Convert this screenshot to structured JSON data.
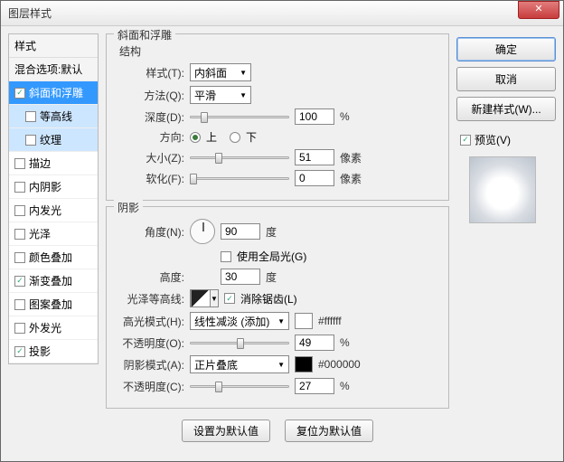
{
  "window": {
    "title": "图层样式"
  },
  "leftPanel": {
    "header": "样式",
    "blend": "混合选项:默认",
    "items": [
      {
        "label": "斜面和浮雕",
        "checked": true,
        "selected": true
      },
      {
        "label": "等高线",
        "checked": false,
        "indent": true,
        "sub": true
      },
      {
        "label": "纹理",
        "checked": false,
        "indent": true,
        "sub": true
      },
      {
        "label": "描边",
        "checked": false
      },
      {
        "label": "内阴影",
        "checked": false
      },
      {
        "label": "内发光",
        "checked": false
      },
      {
        "label": "光泽",
        "checked": false
      },
      {
        "label": "颜色叠加",
        "checked": false
      },
      {
        "label": "渐变叠加",
        "checked": true
      },
      {
        "label": "图案叠加",
        "checked": false
      },
      {
        "label": "外发光",
        "checked": false
      },
      {
        "label": "投影",
        "checked": true
      }
    ]
  },
  "bevel": {
    "groupTitle": "斜面和浮雕",
    "structTitle": "结构",
    "styleLabel": "样式(T):",
    "styleValue": "内斜面",
    "techLabel": "方法(Q):",
    "techValue": "平滑",
    "depthLabel": "深度(D):",
    "depthValue": "100",
    "depthUnit": "%",
    "dirLabel": "方向:",
    "upLabel": "上",
    "downLabel": "下",
    "sizeLabel": "大小(Z):",
    "sizeValue": "51",
    "sizeUnit": "像素",
    "softenLabel": "软化(F):",
    "softenValue": "0",
    "softenUnit": "像素"
  },
  "shade": {
    "title": "阴影",
    "angleLabel": "角度(N):",
    "angleValue": "90",
    "angleUnit": "度",
    "globalLabel": "使用全局光(G)",
    "altLabel": "高度:",
    "altValue": "30",
    "altUnit": "度",
    "glossLabel": "光泽等高线:",
    "aaLabel": "消除锯齿(L)",
    "hiLabel": "高光模式(H):",
    "hiValue": "线性减淡 (添加)",
    "hiHex": "#ffffff",
    "hiOpLabel": "不透明度(O):",
    "hiOpValue": "49",
    "hiOpUnit": "%",
    "shLabel": "阴影模式(A):",
    "shValue": "正片叠底",
    "shHex": "#000000",
    "shOpLabel": "不透明度(C):",
    "shOpValue": "27",
    "shOpUnit": "%"
  },
  "buttons": {
    "makeDefault": "设置为默认值",
    "resetDefault": "复位为默认值",
    "ok": "确定",
    "cancel": "取消",
    "newStyle": "新建样式(W)...",
    "preview": "预览(V)"
  }
}
